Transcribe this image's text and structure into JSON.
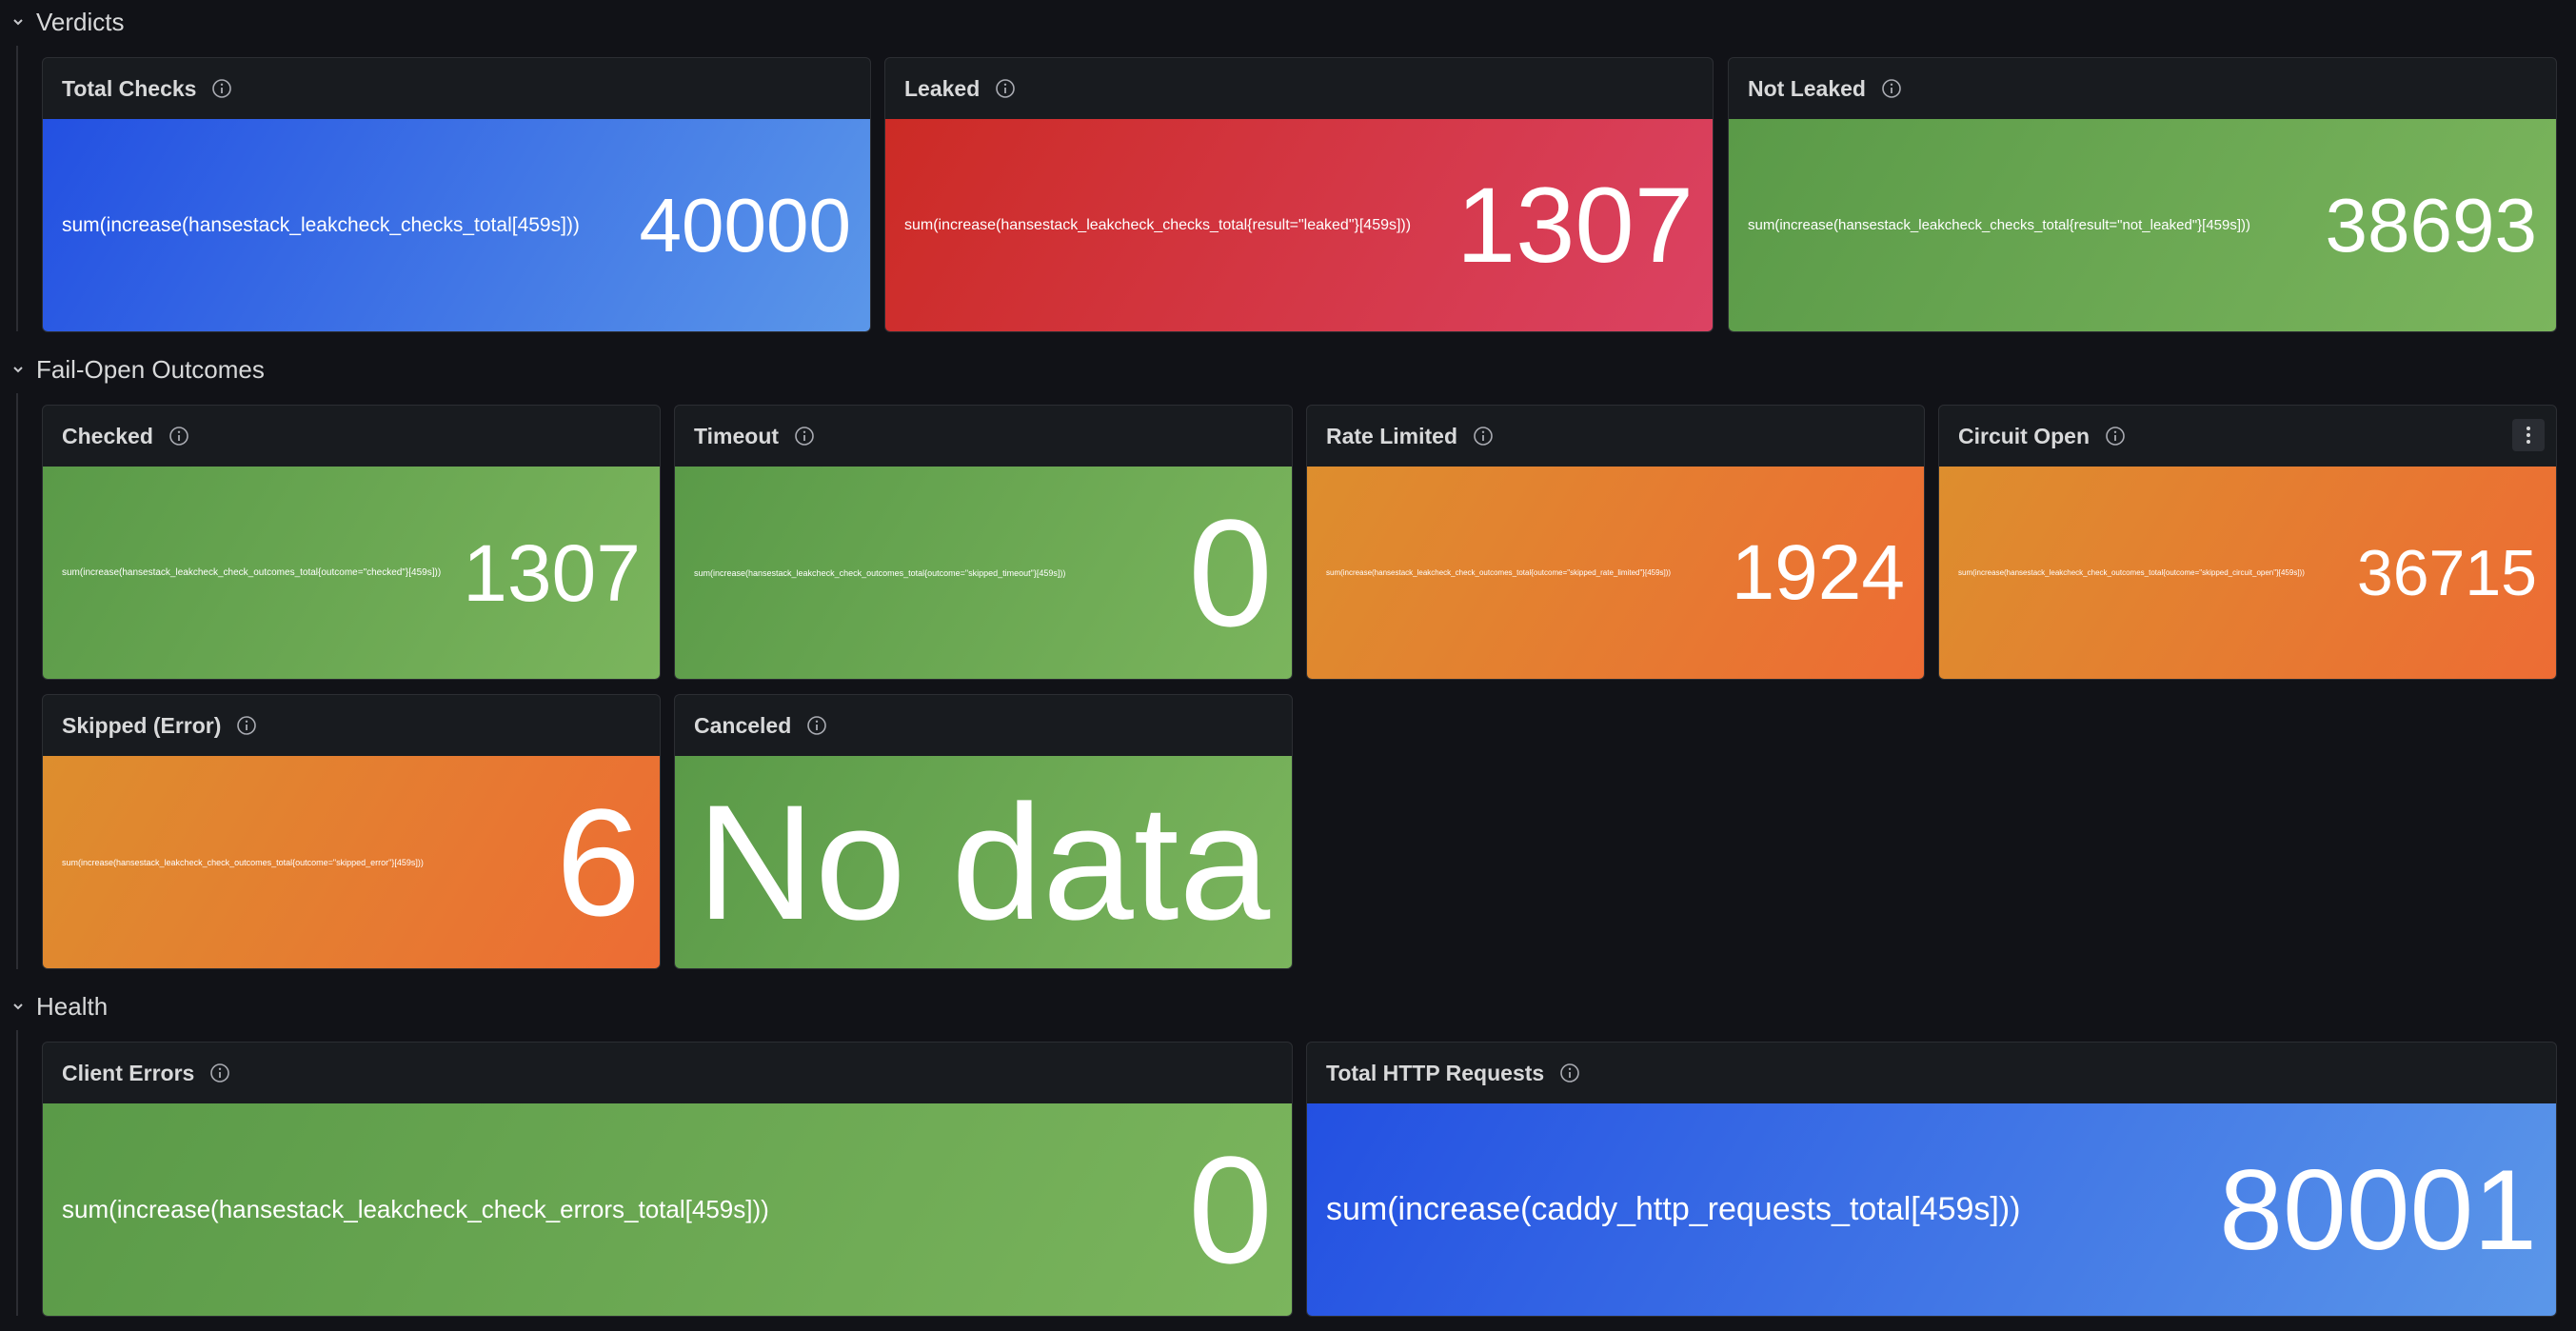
{
  "rows": {
    "verdicts": {
      "title": "Verdicts"
    },
    "fail_open": {
      "title": "Fail-Open Outcomes"
    },
    "health": {
      "title": "Health"
    }
  },
  "panels": {
    "total_checks": {
      "title": "Total Checks",
      "query": "sum(increase(hansestack_leakcheck_checks_total[459s]))",
      "value": "40000",
      "color": "blue"
    },
    "leaked": {
      "title": "Leaked",
      "query": "sum(increase(hansestack_leakcheck_checks_total{result=\"leaked\"}[459s]))",
      "value": "1307",
      "color": "red"
    },
    "not_leaked": {
      "title": "Not Leaked",
      "query": "sum(increase(hansestack_leakcheck_checks_total{result=\"not_leaked\"}[459s]))",
      "value": "38693",
      "color": "green"
    },
    "checked": {
      "title": "Checked",
      "query": "sum(increase(hansestack_leakcheck_check_outcomes_total{outcome=\"checked\"}[459s]))",
      "value": "1307",
      "color": "green"
    },
    "timeout": {
      "title": "Timeout",
      "query": "sum(increase(hansestack_leakcheck_check_outcomes_total{outcome=\"skipped_timeout\"}[459s]))",
      "value": "0",
      "color": "green"
    },
    "rate_limited": {
      "title": "Rate Limited",
      "query": "sum(increase(hansestack_leakcheck_check_outcomes_total{outcome=\"skipped_rate_limited\"}[459s]))",
      "value": "1924",
      "color": "orange"
    },
    "circuit_open": {
      "title": "Circuit Open",
      "query": "sum(increase(hansestack_leakcheck_check_outcomes_total{outcome=\"skipped_circuit_open\"}[459s]))",
      "value": "36715",
      "color": "orange"
    },
    "skipped_error": {
      "title": "Skipped (Error)",
      "query": "sum(increase(hansestack_leakcheck_check_outcomes_total{outcome=\"skipped_error\"}[459s]))",
      "value": "6",
      "color": "orange"
    },
    "canceled": {
      "title": "Canceled",
      "value": "No data",
      "color": "green"
    },
    "client_errors": {
      "title": "Client Errors",
      "query": "sum(increase(hansestack_leakcheck_check_errors_total[459s]))",
      "value": "0",
      "color": "green"
    },
    "total_http_requests": {
      "title": "Total HTTP Requests",
      "query": "sum(increase(caddy_http_requests_total[459s]))",
      "value": "80001",
      "color": "blue"
    }
  },
  "icons": {
    "row_toggle": "chevron-down-icon",
    "panel_info": "info-circle-icon",
    "panel_menu": "kebab-menu-icon"
  },
  "colors": {
    "background": "#111217",
    "panel": "#181b1f",
    "blue": "#3d74e6",
    "red": "#d4343c",
    "green": "#6aa853",
    "orange": "#e67d31"
  }
}
